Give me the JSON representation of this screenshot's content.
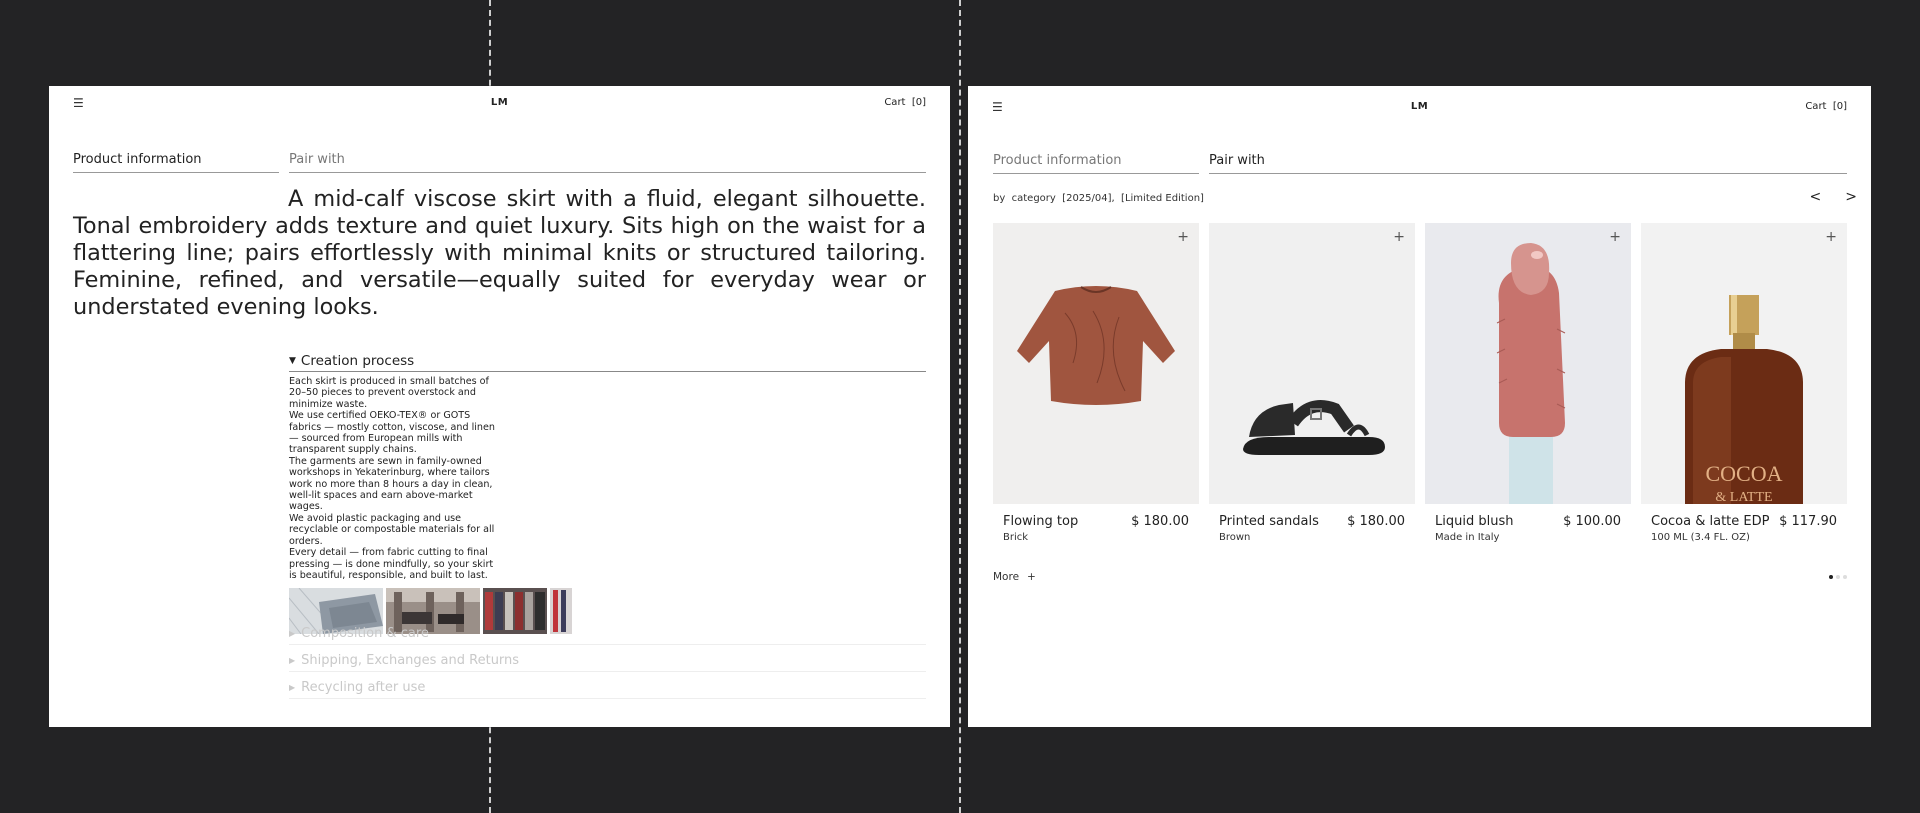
{
  "left": {
    "header": {
      "menu_icon": "menu-icon",
      "menu_glyph": "☰",
      "logo": "LM",
      "cart": "Cart  [0]"
    },
    "tabs": {
      "product_info": "Product information",
      "pair_with": "Pair with"
    },
    "description": "A mid-calf viscose skirt with a fluid, elegant silhouette. Tonal embroidery adds texture and quiet luxury. Sits high on the waist for a flattering line; pairs effortlessly with minimal knits or structured tailoring. Feminine, refined, and versatile—equally suited for everyday wear or understated evening looks.",
    "creation": {
      "title": "Creation process",
      "paragraphs": [
        "Each skirt is produced in small batches of 20–50 pieces to prevent overstock and minimize waste.",
        "We use certified OEKO-TEX® or GOTS fabrics — mostly cotton, viscose, and linen — sourced from European mills with transparent supply chains.",
        "The garments are sewn in family-owned workshops in Yekaterinburg, where tailors work no more than 8 hours a day in clean, well-lit spaces and earn above-market wages.",
        "We avoid plastic packaging and use recyclable or compostable materials for all orders.",
        "Every detail — from fabric cutting to final pressing — is done mindfully, so your skirt is beautiful, responsible, and built to last."
      ]
    },
    "sections": [
      "Composition & care",
      "Shipping, Exchanges and Returns",
      "Recycling after use"
    ]
  },
  "right": {
    "header": {
      "menu_icon": "menu-icon",
      "menu_glyph": "☰",
      "logo": "LM",
      "cart": "Cart  [0]"
    },
    "tabs": {
      "product_info": "Product information",
      "pair_with": "Pair with"
    },
    "filter": "by  category  [2025/04],  [Limited Edition]",
    "prev": "<",
    "next": ">",
    "products": [
      {
        "name": "Flowing top",
        "price": "$ 180.00",
        "sub": "Brick"
      },
      {
        "name": "Printed sandals",
        "price": "$ 180.00",
        "sub": "Brown"
      },
      {
        "name": "Liquid blush",
        "price": "$ 100.00",
        "sub": "Made in Italy"
      },
      {
        "name": "Cocoa & latte EDP",
        "price": "$ 117.90",
        "sub": "100 ML (3.4 FL. OZ)",
        "bottle_label_1": "COCOA",
        "bottle_label_2": "& LATTE"
      }
    ],
    "plus": "+",
    "more": "More",
    "more_plus": "+",
    "pagination": {
      "pages": 3,
      "current": 1
    }
  }
}
